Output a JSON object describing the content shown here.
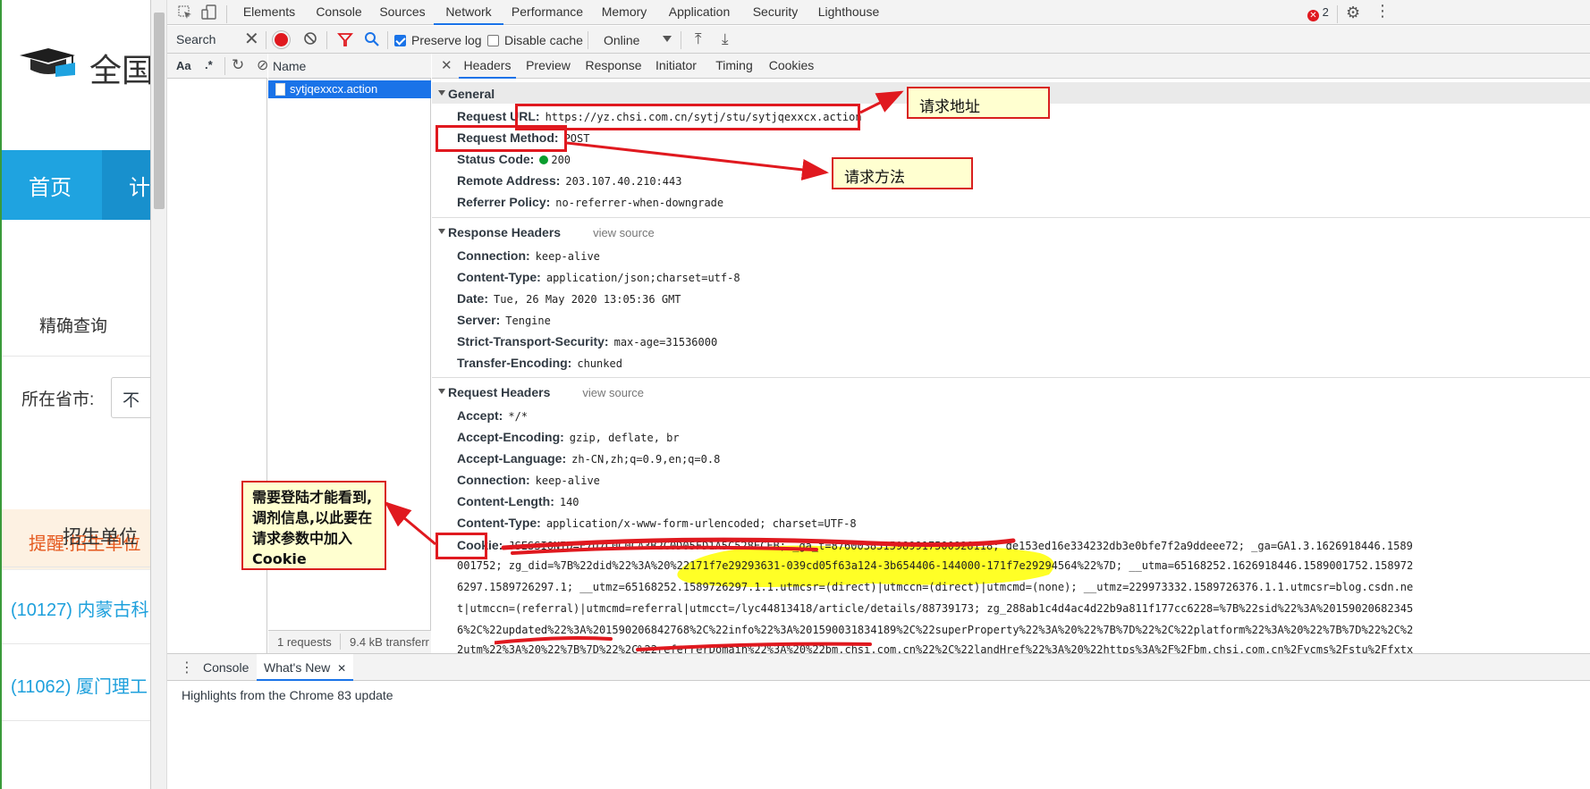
{
  "webpage": {
    "logo_text": "全国",
    "nav_home": "首页",
    "nav_next": "计",
    "precise_query": "精确查询",
    "province_label": "所在省市:",
    "province_value": "不",
    "reminder": "提醒:招生单位",
    "unit_header": "招生单位",
    "link1": "(10127) 内蒙古科",
    "link2": "(11062) 厦门理工"
  },
  "devtools": {
    "tabs": [
      "Elements",
      "Console",
      "Sources",
      "Network",
      "Performance",
      "Memory",
      "Application",
      "Security",
      "Lighthouse"
    ],
    "active_tab": "Network",
    "error_count": "2",
    "search_label": "Search",
    "toolbar": {
      "preserve_log": "Preserve log",
      "disable_cache": "Disable cache",
      "throttle": "Online"
    },
    "search_options": {
      "case": "Aa",
      "regex": ".*"
    },
    "request_list": {
      "header": "Name",
      "selected": "sytjqexxcx.action",
      "count": "1 requests",
      "transfer": "9.4 kB transferr"
    },
    "detail_tabs": [
      "Headers",
      "Preview",
      "Response",
      "Initiator",
      "Timing",
      "Cookies"
    ],
    "general": {
      "title": "General",
      "request_url_key": "Request URL:",
      "request_url": "https://yz.chsi.com.cn/sytj/stu/sytjqexxcx.action",
      "method_key": "Request Method:",
      "method": "POST",
      "status_key": "Status Code:",
      "status": "200",
      "remote_key": "Remote Address:",
      "remote": "203.107.40.210:443",
      "referrer_key": "Referrer Policy:",
      "referrer": "no-referrer-when-downgrade"
    },
    "response_headers": {
      "title": "Response Headers",
      "view_source": "view source",
      "rows": [
        {
          "k": "Connection:",
          "v": "keep-alive"
        },
        {
          "k": "Content-Type:",
          "v": "application/json;charset=utf-8"
        },
        {
          "k": "Date:",
          "v": "Tue, 26 May 2020 13:05:36 GMT"
        },
        {
          "k": "Server:",
          "v": "Tengine"
        },
        {
          "k": "Strict-Transport-Security:",
          "v": "max-age=31536000"
        },
        {
          "k": "Transfer-Encoding:",
          "v": "chunked"
        }
      ]
    },
    "request_headers": {
      "title": "Request Headers",
      "view_source": "view source",
      "rows": [
        {
          "k": "Accept:",
          "v": "*/*"
        },
        {
          "k": "Accept-Encoding:",
          "v": "gzip, deflate, br"
        },
        {
          "k": "Accept-Language:",
          "v": "zh-CN,zh;q=0.9,en;q=0.8"
        },
        {
          "k": "Connection:",
          "v": "keep-alive"
        },
        {
          "k": "Content-Length:",
          "v": "140"
        },
        {
          "k": "Content-Type:",
          "v": "application/x-www-form-urlencoded; charset=UTF-8"
        }
      ],
      "cookie_key": "Cookie:",
      "cookie_lines": [
        "JSESSIONID=F7D7C0C0CA3B2C0D05FD1A5C528ECEB; _ga_t=8760038515989917500928118; de153ed16e334232db3e0bfe7f2a9ddeee72; _ga=GA1.3.1626918446.1589",
        "001752; zg_did=%7B%22did%22%3A%20%22171f7e29293631-039cd05f63a124-3b654406-144000-171f7e29294564%22%7D; __utma=65168252.1626918446.1589001752.158972",
        "6297.1589726297.1; __utmz=65168252.1589726297.1.1.utmcsr=(direct)|utmccn=(direct)|utmcmd=(none); __utmz=229973332.1589726376.1.1.utmcsr=blog.csdn.ne",
        "t|utmccn=(referral)|utmcmd=referral|utmcct=/lyc44813418/article/details/88739173; zg_288ab1c4d4ac4d22b9a811f177cc6228=%7B%22sid%22%3A%20159020682345",
        "6%2C%22updated%22%3A%201590206842768%2C%22info%22%3A%201590031834189%2C%22superProperty%22%3A%20%22%7B%7D%22%2C%22platform%22%3A%20%22%7B%7D%22%2C%2",
        "2utm%22%3A%20%22%7B%7D%22%2C%22referrerDomain%22%3A%20%22bm.chsi.com.cn%22%2C%22landHref%22%3A%20%22https%3A%2F%2Fbm.chsi.com.cn%2Fycms%2Fstu%2Ffxtx"
      ]
    },
    "drawer": {
      "tabs": [
        "Console",
        "What's New"
      ],
      "active": "What's New",
      "content": "Highlights from the Chrome 83 update"
    }
  },
  "annotations": {
    "url_note": "请求地址",
    "method_note": "请求方法",
    "cookie_note": "需要登陆才能看到,调剂信息,以此要在请求参数中加入Cookie"
  },
  "colors": {
    "annotation_red": "#e0191f",
    "annotation_bg": "#ffffd0",
    "highlight_yellow": "#ffff00",
    "nav_blue": "#1fa3e0",
    "devtools_accent": "#1a73e8"
  }
}
